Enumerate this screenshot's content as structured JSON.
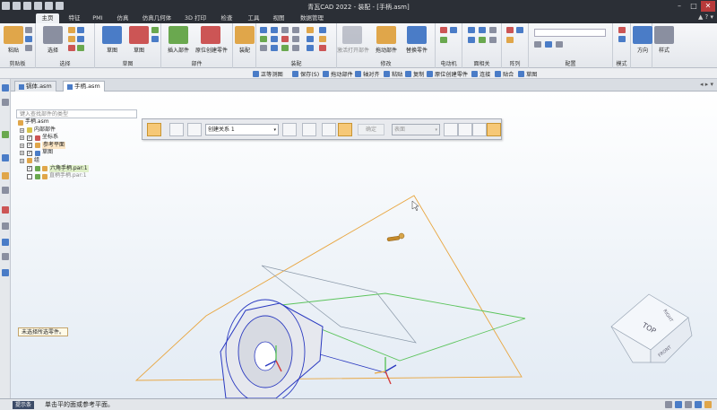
{
  "app": {
    "title": "青瓦CAD 2022 - 装配 - [手柄.asm]",
    "window_controls": {
      "minimize": "–",
      "maximize": "□",
      "close": "✕"
    }
  },
  "ribbon_tabs": [
    {
      "label": "主页",
      "active": true
    },
    {
      "label": "特征"
    },
    {
      "label": "PMI"
    },
    {
      "label": "仿真"
    },
    {
      "label": "仿真几何体"
    },
    {
      "label": "3D 打印"
    },
    {
      "label": "检查"
    },
    {
      "label": "工具"
    },
    {
      "label": "视图"
    },
    {
      "label": "数据管理"
    }
  ],
  "ribbon_right": "▲ ? ▾",
  "ribbon_groups": [
    {
      "label": "剪贴板",
      "big": "粘贴"
    },
    {
      "label": "选择",
      "big": "选择"
    },
    {
      "label": "草图",
      "big": "草图",
      "big2": "草图"
    },
    {
      "label": "部件",
      "big": "插入部件",
      "big2": "原位创建零件"
    },
    {
      "label": "装配",
      "big": "装配"
    },
    {
      "label": "装配"
    },
    {
      "label": "修改",
      "big": "激活打开部件",
      "big2": "拖动部件",
      "big3": "替换零件"
    },
    {
      "label": "电动机"
    },
    {
      "label": "面相关"
    },
    {
      "label": "阵列"
    },
    {
      "label": "配置"
    },
    {
      "label": "模式"
    },
    {
      "label": "方向",
      "big": "方向"
    },
    {
      "label": "样式",
      "big": "样式"
    }
  ],
  "command_bar": [
    "正等测图",
    "保存(S)",
    "拖动部件",
    "轴对齐",
    "粘贴",
    "复制",
    "原位创建零件",
    "连接",
    "贴合",
    "草图"
  ],
  "doc_tabs": [
    {
      "label": "锅体.asm",
      "active": false
    },
    {
      "label": "手柄.asm",
      "active": true
    }
  ],
  "doc_tabs_right": "◂ ▸ ▾",
  "pathfinder": {
    "search_placeholder": "键入查找部件的类型",
    "tree": [
      {
        "label": "手柄.asm",
        "level": 0,
        "expander": "-"
      },
      {
        "label": "内部部件",
        "level": 1,
        "expander": "+"
      },
      {
        "label": "坐标系",
        "level": 1,
        "expander": "+"
      },
      {
        "label": "参考平面",
        "level": 1,
        "expander": "+"
      },
      {
        "label": "草图",
        "level": 1,
        "expander": "+"
      },
      {
        "label": "组",
        "level": 1,
        "expander": "+"
      },
      {
        "label": "六角手柄.par:1",
        "level": 1,
        "expander": ""
      },
      {
        "label": "直柄手柄.par:1",
        "level": 1,
        "expander": ""
      }
    ]
  },
  "assembly_toolbar": {
    "relation_combo": "创建关系 1",
    "apply_label": "确定",
    "surface_combo": "表面"
  },
  "hint_text": "未选择所选零件。",
  "view_cube": {
    "top": "TOP",
    "right": "RIGHT",
    "front": "FRONT"
  },
  "status": {
    "tip_label": "提示条",
    "message": "单击平的面或参考平面。"
  },
  "colors": {
    "accent": "#f6c877",
    "titlebar": "#2b2f36",
    "plane_orange": "#e8a640",
    "plane_green": "#5cc45c",
    "part_blue": "#2a39c0"
  }
}
